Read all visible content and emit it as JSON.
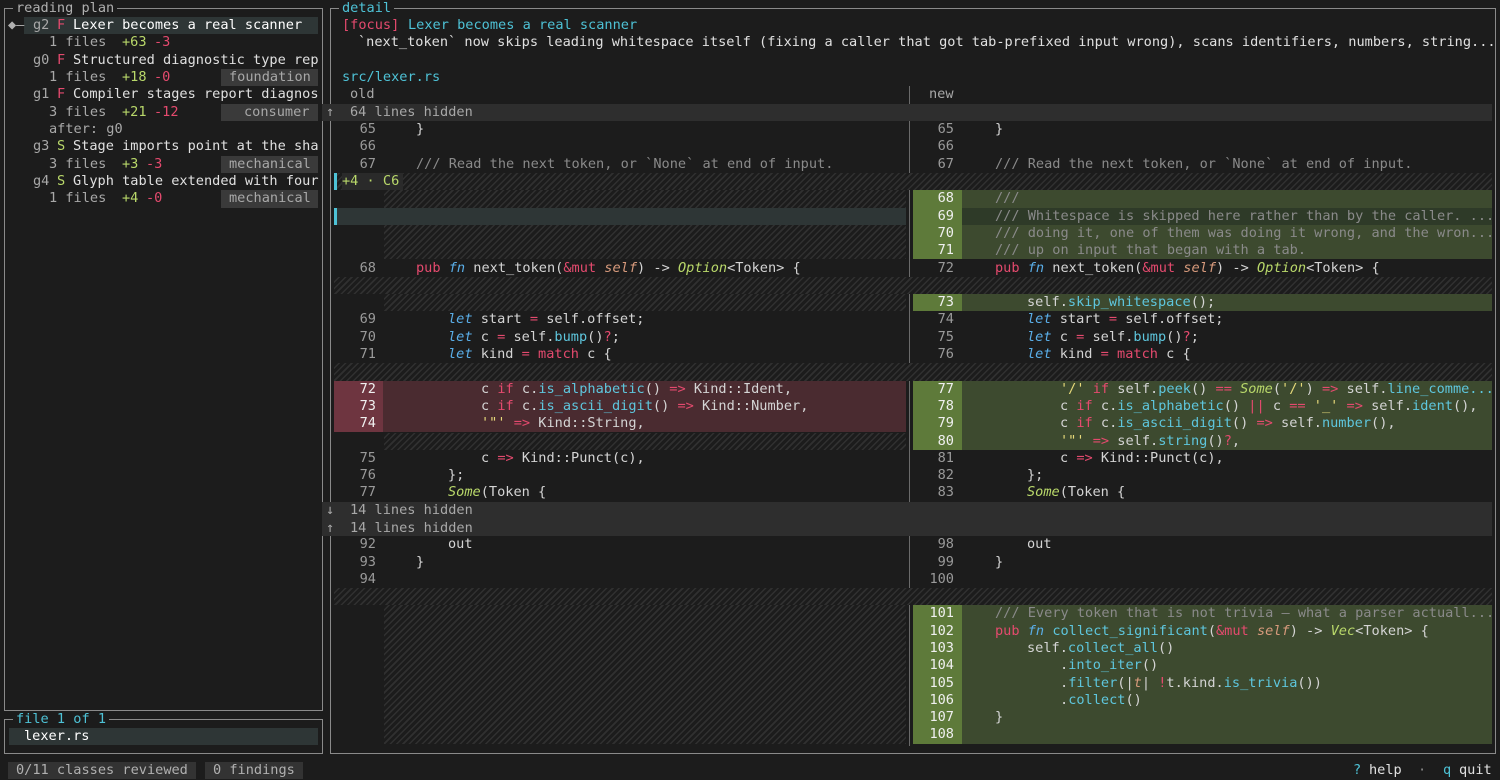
{
  "left_panel": {
    "title": "reading plan",
    "groups": [
      {
        "id": "g2",
        "kind": "F",
        "title": "Lexer becomes a real scanner",
        "files": "1 files",
        "plus": "+63",
        "minus": "-3",
        "tag": "",
        "after": ""
      },
      {
        "id": "g0",
        "kind": "F",
        "title": "Structured diagnostic type rep",
        "files": "1 files",
        "plus": "+18",
        "minus": "-0",
        "tag": "foundation",
        "after": ""
      },
      {
        "id": "g1",
        "kind": "F",
        "title": "Compiler stages report diagnos",
        "files": "3 files",
        "plus": "+21",
        "minus": "-12",
        "tag": "consumer",
        "after": "after: g0"
      },
      {
        "id": "g3",
        "kind": "S",
        "title": "Stage imports point at the sha",
        "files": "3 files",
        "plus": "+3",
        "minus": "-3",
        "tag": "mechanical",
        "after": ""
      },
      {
        "id": "g4",
        "kind": "S",
        "title": "Glyph table extended with four",
        "files": "1 files",
        "plus": "+4",
        "minus": "-0",
        "tag": "mechanical",
        "after": ""
      }
    ],
    "file_box_title": "file 1 of 1",
    "file_name": "lexer.rs"
  },
  "detail": {
    "title": "detail",
    "focus_tag": "[focus]",
    "focus_title": "Lexer becomes a real scanner",
    "description": "`next_token` now skips leading whitespace itself (fixing a caller that got tab-prefixed input wrong), scans identifiers, numbers, string...",
    "file_path": "src/lexer.rs",
    "old_label": "old",
    "new_label": "new",
    "hidden_top": "64 lines hidden",
    "hunk_label": "+4 · C6",
    "hidden_mid1": "14 lines hidden",
    "hidden_mid2": "14 lines hidden",
    "arrow_up": "↑",
    "arrow_down": "↓"
  },
  "colors": {
    "add": "#3d4a2f",
    "add_num": "#5e7a3a",
    "del": "#4a2b30",
    "del_num": "#6e3540",
    "accent": "#4ec2d6"
  },
  "status_bar": {
    "reviewed": "0/11 classes reviewed",
    "findings": "0 findings",
    "help_key": "?",
    "help_label": "help",
    "sep": "·",
    "quit_key": "q",
    "quit_label": "quit"
  }
}
